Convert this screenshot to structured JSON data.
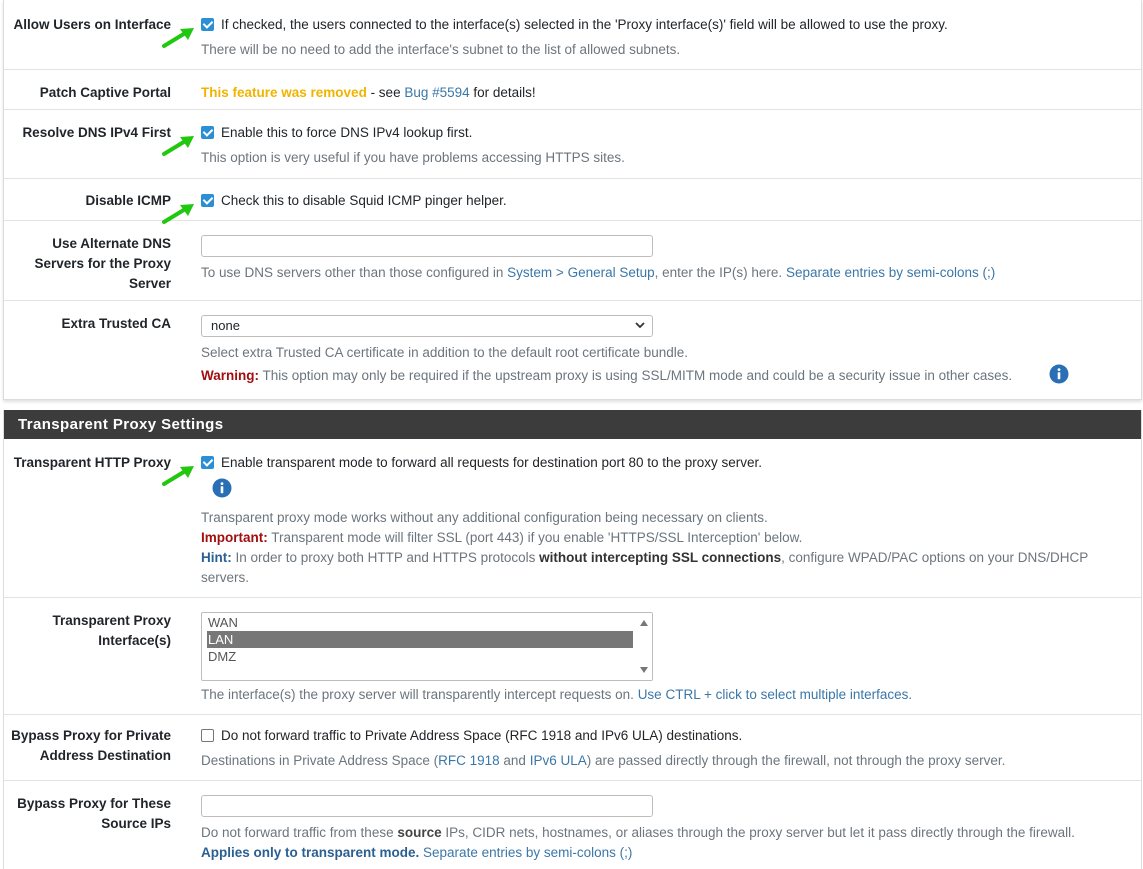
{
  "settings": {
    "allow_users": {
      "label": "Allow Users on Interface",
      "checked": true,
      "checkbox_text": "If checked, the users connected to the interface(s) selected in the 'Proxy interface(s)' field will be allowed to use the proxy.",
      "help": "There will be no need to add the interface's subnet to the list of allowed subnets."
    },
    "patch_captive": {
      "label": "Patch Captive Portal",
      "removed_text": "This feature was removed",
      "see_text": " - see ",
      "bug_link": "Bug #5594",
      "details_text": " for details!"
    },
    "resolve_dns": {
      "label": "Resolve DNS IPv4 First",
      "checked": true,
      "checkbox_text": "Enable this to force DNS IPv4 lookup first.",
      "help": "This option is very useful if you have problems accessing HTTPS sites."
    },
    "disable_icmp": {
      "label": "Disable ICMP",
      "checked": true,
      "checkbox_text": "Check this to disable Squid ICMP pinger helper."
    },
    "alt_dns": {
      "label_line1": "Use Alternate DNS",
      "label_line2": "Servers for the Proxy",
      "label_line3": "Server",
      "value": "",
      "help_prefix": "To use DNS servers other than those configured in ",
      "help_link1": "System > General Setup",
      "help_mid": ", enter the IP(s) here. ",
      "help_link2": "Separate entries by semi-colons (;)"
    },
    "extra_ca": {
      "label": "Extra Trusted CA",
      "selected": "none",
      "help": "Select extra Trusted CA certificate in addition to the default root certificate bundle.",
      "warning_label": "Warning:",
      "warning_text": " This option may only be required if the upstream proxy is using SSL/MITM mode and could be a security issue in other cases."
    }
  },
  "transparent": {
    "heading": "Transparent Proxy Settings",
    "http_proxy": {
      "label": "Transparent HTTP Proxy",
      "checked": true,
      "checkbox_text": "Enable transparent mode to forward all requests for destination port 80 to the proxy server.",
      "help1": "Transparent proxy mode works without any additional configuration being necessary on clients.",
      "important_label": "Important:",
      "important_text": " Transparent mode will filter SSL (port 443) if you enable 'HTTPS/SSL Interception' below.",
      "hint_label": "Hint:",
      "hint_text1": " In order to proxy both HTTP and HTTPS protocols ",
      "hint_bold": "without intercepting SSL connections",
      "hint_text2": ", configure WPAD/PAC options on your DNS/DHCP",
      "hint_text3": "servers."
    },
    "interfaces": {
      "label_line1": "Transparent Proxy",
      "label_line2": "Interface(s)",
      "options": [
        "WAN",
        "LAN",
        "DMZ"
      ],
      "selected": "LAN",
      "help_prefix": "The interface(s) the proxy server will transparently intercept requests on. ",
      "help_link": "Use CTRL + click to select multiple interfaces."
    },
    "bypass_private": {
      "label_line1": "Bypass Proxy for Private",
      "label_line2": "Address Destination",
      "checked": false,
      "checkbox_text": "Do not forward traffic to Private Address Space (RFC 1918 and IPv6 ULA) destinations.",
      "help_prefix": "Destinations in Private Address Space (",
      "help_link1": "RFC 1918",
      "help_and": " and ",
      "help_link2": "IPv6 ULA",
      "help_suffix": ") are passed directly through the firewall, not through the proxy server."
    },
    "bypass_source": {
      "label_line1": "Bypass Proxy for These",
      "label_line2": "Source IPs",
      "value": "",
      "help_prefix": "Do not forward traffic from these ",
      "help_bold": "source",
      "help_suffix": " IPs, CIDR nets, hostnames, or aliases through the proxy server but let it pass directly through the firewall.",
      "applies_bold": "Applies only to transparent mode.",
      "applies_link": " Separate entries by semi-colons (;)"
    }
  },
  "colors": {
    "removed": "#f0b400",
    "warning": "#a10e0e",
    "link": "#3a77a8",
    "heading_bg": "#3c3c3c",
    "arrow": "#22c80f"
  }
}
